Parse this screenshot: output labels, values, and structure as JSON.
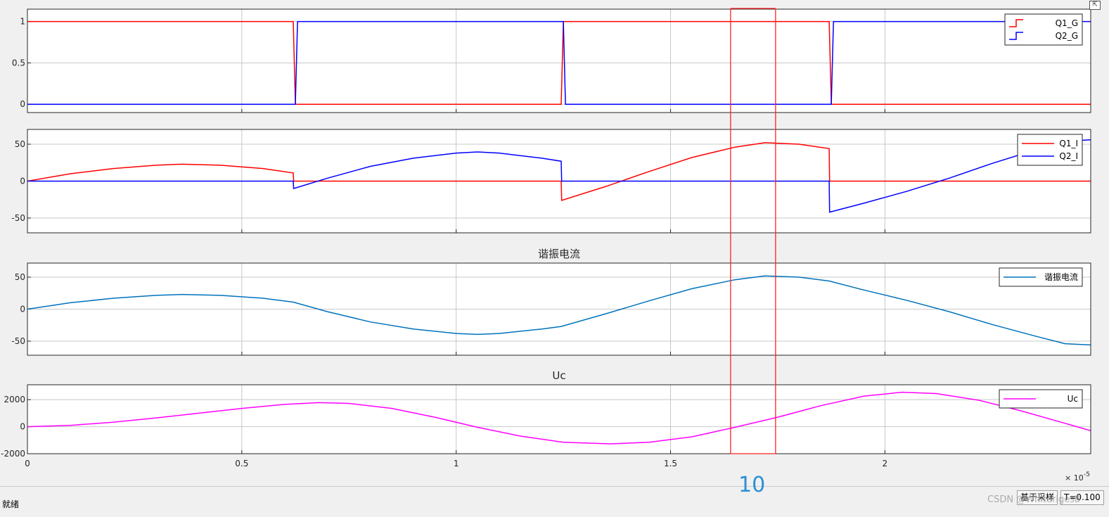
{
  "app": {
    "status_text": "就绪",
    "sampling_label": "基于采样",
    "time_label": "T=0.100",
    "watermark": "CSDN @Whiteriges8",
    "marker_label": "10"
  },
  "colors": {
    "q1": "#ff0000",
    "q2": "#0000ff",
    "resonant": "#0072bd",
    "uc": "#ff00ff",
    "marker": "#ff2222",
    "grid": "#c8c8c8"
  },
  "x_axis": {
    "range": [
      0,
      2.48
    ],
    "ticks": [
      0,
      0.5,
      1,
      1.5,
      2
    ],
    "tick_labels": [
      "0",
      "0.5",
      "1",
      "1.5",
      "2"
    ],
    "exponent_label": "× 10",
    "exponent_power": "-5"
  },
  "marker_region": {
    "x_start": 1.64,
    "x_end": 1.745
  },
  "chart_data": [
    {
      "type": "line",
      "title": "",
      "ylim": [
        -0.1,
        1.15
      ],
      "yticks": [
        0,
        0.5,
        1
      ],
      "ytick_labels": [
        "0",
        "0.5",
        "1"
      ],
      "legend_position": "top-right",
      "series": [
        {
          "name": "Q1_G",
          "color_key": "q1",
          "style": "step",
          "x": [
            0,
            0.62,
            0.625,
            1.245,
            1.25,
            1.87,
            1.875,
            2.48
          ],
          "y": [
            1,
            1,
            0,
            0,
            1,
            1,
            0,
            0
          ]
        },
        {
          "name": "Q2_G",
          "color_key": "q2",
          "style": "step",
          "x": [
            0,
            0.625,
            0.63,
            1.25,
            1.255,
            1.875,
            1.88,
            2.48
          ],
          "y": [
            0,
            0,
            1,
            1,
            0,
            0,
            1,
            1
          ]
        }
      ]
    },
    {
      "type": "line",
      "title": "",
      "ylim": [
        -70,
        70
      ],
      "yticks": [
        -50,
        0,
        50
      ],
      "ytick_labels": [
        "-50",
        "0",
        "50"
      ],
      "legend_position": "top-right",
      "series": [
        {
          "name": "Q1_I",
          "color_key": "q1",
          "x": [
            0,
            0.1,
            0.2,
            0.3,
            0.36,
            0.45,
            0.55,
            0.62,
            0.621,
            1.245,
            1.246,
            1.35,
            1.45,
            1.55,
            1.65,
            1.72,
            1.8,
            1.87,
            1.871,
            2.48
          ],
          "y": [
            0,
            10,
            17,
            21.5,
            23,
            21.5,
            17,
            11,
            0,
            0,
            -26,
            -7,
            13,
            32,
            46,
            52,
            50,
            44,
            0,
            0
          ]
        },
        {
          "name": "Q2_I",
          "color_key": "q2",
          "x": [
            0,
            0.62,
            0.621,
            0.7,
            0.8,
            0.9,
            1.0,
            1.05,
            1.1,
            1.2,
            1.245,
            1.246,
            1.87,
            1.871,
            1.95,
            2.05,
            2.15,
            2.25,
            2.35,
            2.42,
            2.48
          ],
          "y": [
            0,
            0,
            -10,
            4,
            20,
            31,
            38,
            39.5,
            38,
            31,
            27,
            0,
            0,
            -42,
            -30,
            -14,
            4,
            24,
            42,
            54,
            56
          ]
        }
      ]
    },
    {
      "type": "line",
      "title": "谐振电流",
      "ylim": [
        -72,
        72
      ],
      "yticks": [
        -50,
        0,
        50
      ],
      "ytick_labels": [
        "-50",
        "0",
        "50"
      ],
      "legend_position": "top-right",
      "series": [
        {
          "name": "谐振电流",
          "color_key": "resonant",
          "x": [
            0,
            0.1,
            0.2,
            0.3,
            0.36,
            0.45,
            0.55,
            0.62,
            0.7,
            0.8,
            0.9,
            1.0,
            1.05,
            1.1,
            1.2,
            1.245,
            1.35,
            1.45,
            1.55,
            1.65,
            1.72,
            1.8,
            1.87,
            1.95,
            2.05,
            2.15,
            2.25,
            2.35,
            2.42,
            2.48
          ],
          "y": [
            0,
            10,
            17,
            21.5,
            23,
            21.5,
            17,
            11,
            -4,
            -20,
            -31,
            -38,
            -39.5,
            -38,
            -31,
            -27,
            -7,
            13,
            32,
            46,
            52,
            50,
            44,
            30,
            14,
            -4,
            -24,
            -42,
            -54,
            -56
          ]
        }
      ]
    },
    {
      "type": "line",
      "title": "Uc",
      "ylim": [
        -2000,
        3100
      ],
      "yticks": [
        -2000,
        0,
        2000
      ],
      "ytick_labels": [
        "-2000",
        "0",
        "2000"
      ],
      "legend_position": "top-right",
      "series": [
        {
          "name": "Uc",
          "color_key": "uc",
          "x": [
            0,
            0.1,
            0.2,
            0.3,
            0.4,
            0.5,
            0.6,
            0.68,
            0.75,
            0.85,
            0.95,
            1.05,
            1.15,
            1.25,
            1.36,
            1.45,
            1.55,
            1.65,
            1.75,
            1.85,
            1.95,
            2.04,
            2.12,
            2.22,
            2.32,
            2.42,
            2.48
          ],
          "y": [
            0,
            90,
            330,
            650,
            1000,
            1350,
            1650,
            1780,
            1720,
            1350,
            700,
            -50,
            -700,
            -1150,
            -1270,
            -1150,
            -750,
            -50,
            700,
            1550,
            2250,
            2550,
            2450,
            1950,
            1150,
            250,
            -300
          ]
        }
      ]
    }
  ]
}
